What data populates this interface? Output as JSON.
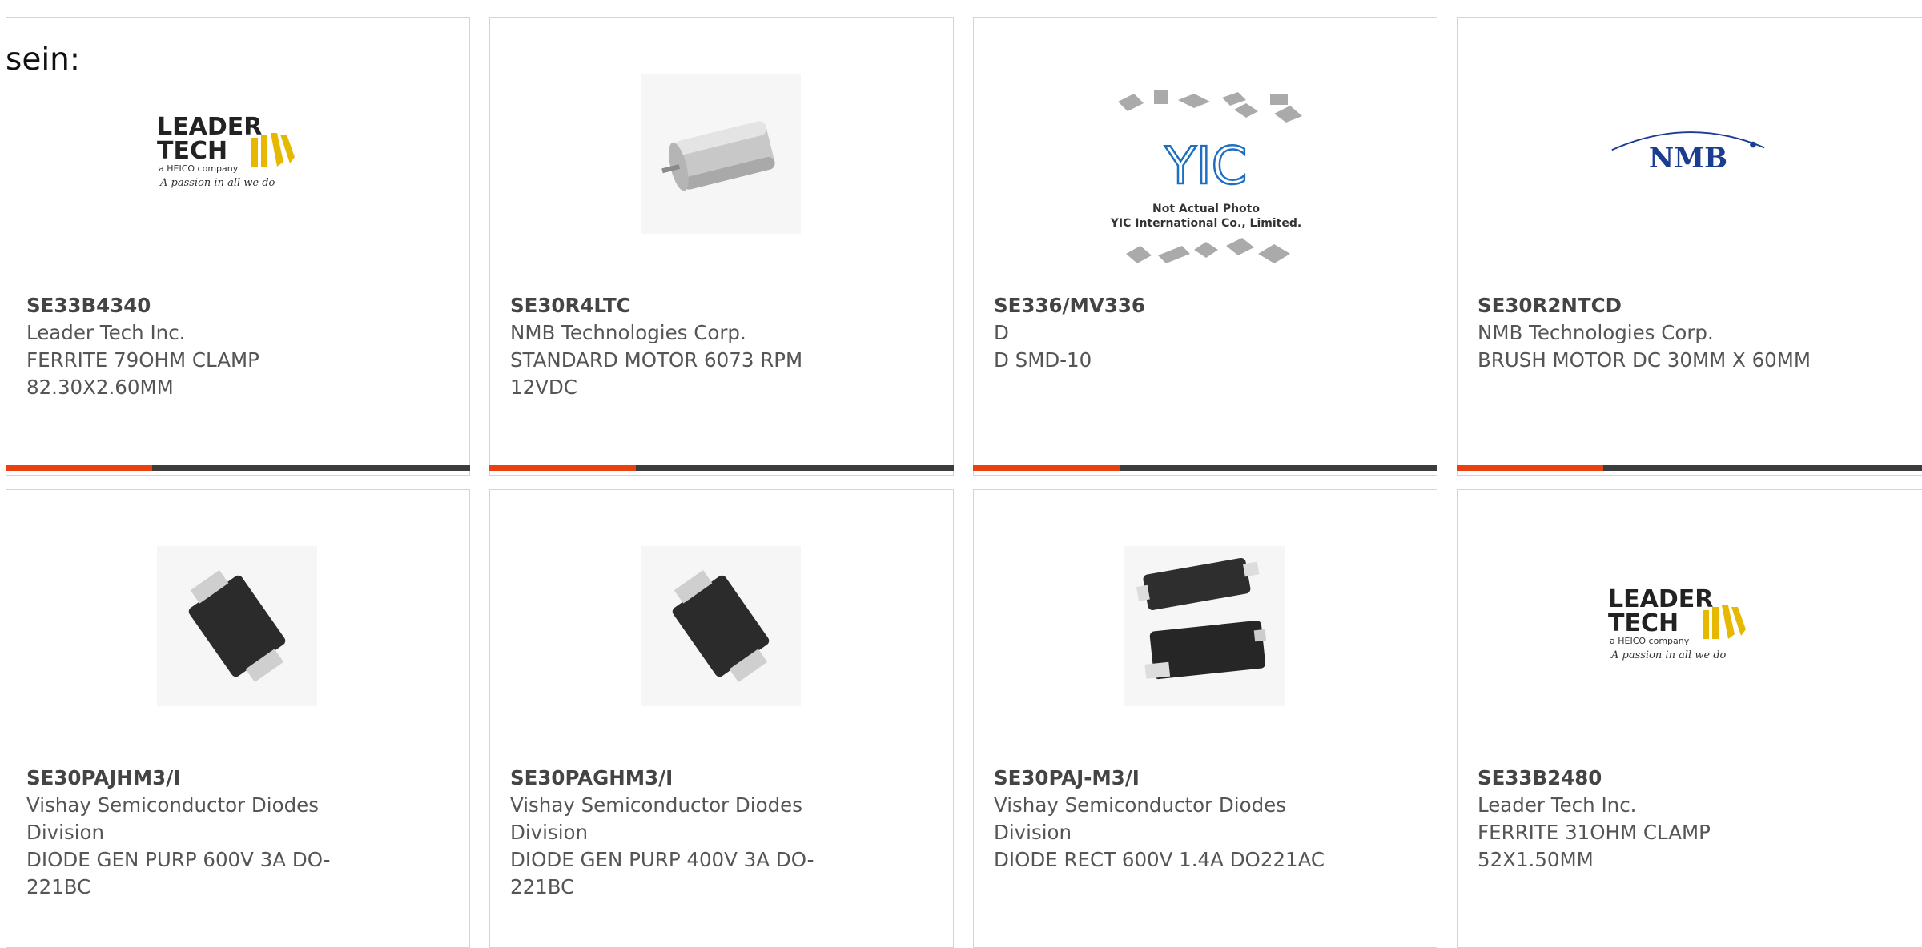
{
  "intro_text": "sein:",
  "colors": {
    "accent": "#e8410f",
    "bar": "#3c3c3c",
    "border": "#d4d4d4"
  },
  "products": [
    {
      "part": "SE33B4340",
      "manufacturer": "Leader Tech Inc.",
      "description": "FERRITE 79OHM CLAMP 82.30X2.60MM",
      "image_icon": "leader-tech-logo",
      "logo_lines": [
        "LEADER",
        "TECH",
        "a HEICO company",
        "A passion in all we do"
      ]
    },
    {
      "part": "SE30R4LTC",
      "manufacturer": "NMB Technologies Corp.",
      "description": "STANDARD MOTOR 6073 RPM 12VDC",
      "image_icon": "dc-motor-photo"
    },
    {
      "part": "SE336/MV336",
      "manufacturer": "D",
      "description": "D SMD-10",
      "image_icon": "not-actual-photo-placeholder",
      "placeholder_lines": [
        "YIC",
        "Not Actual Photo",
        "YIC International Co., Limited."
      ]
    },
    {
      "part": "SE30R2NTCD",
      "manufacturer": "NMB Technologies Corp.",
      "description": "BRUSH MOTOR DC 30MM X 60MM",
      "image_icon": "nmb-logo",
      "logo_text": "NMB"
    },
    {
      "part": "SE30PAJHM3/I",
      "manufacturer": "Vishay Semiconductor Diodes Division",
      "description": "DIODE GEN PURP 600V 3A DO-221BC",
      "image_icon": "diode-package-photo"
    },
    {
      "part": "SE30PAGHM3/I",
      "manufacturer": "Vishay Semiconductor Diodes Division",
      "description": "DIODE GEN PURP 400V 3A DO-221BC",
      "image_icon": "diode-package-photo"
    },
    {
      "part": "SE30PAJ-M3/I",
      "manufacturer": "Vishay Semiconductor Diodes Division",
      "description": "DIODE RECT 600V 1.4A DO221AC",
      "image_icon": "diode-pair-photo"
    },
    {
      "part": "SE33B2480",
      "manufacturer": "Leader Tech Inc.",
      "description": "FERRITE 31OHM CLAMP 52X1.50MM",
      "image_icon": "leader-tech-logo",
      "logo_lines": [
        "LEADER",
        "TECH",
        "a HEICO company",
        "A passion in all we do"
      ]
    }
  ]
}
